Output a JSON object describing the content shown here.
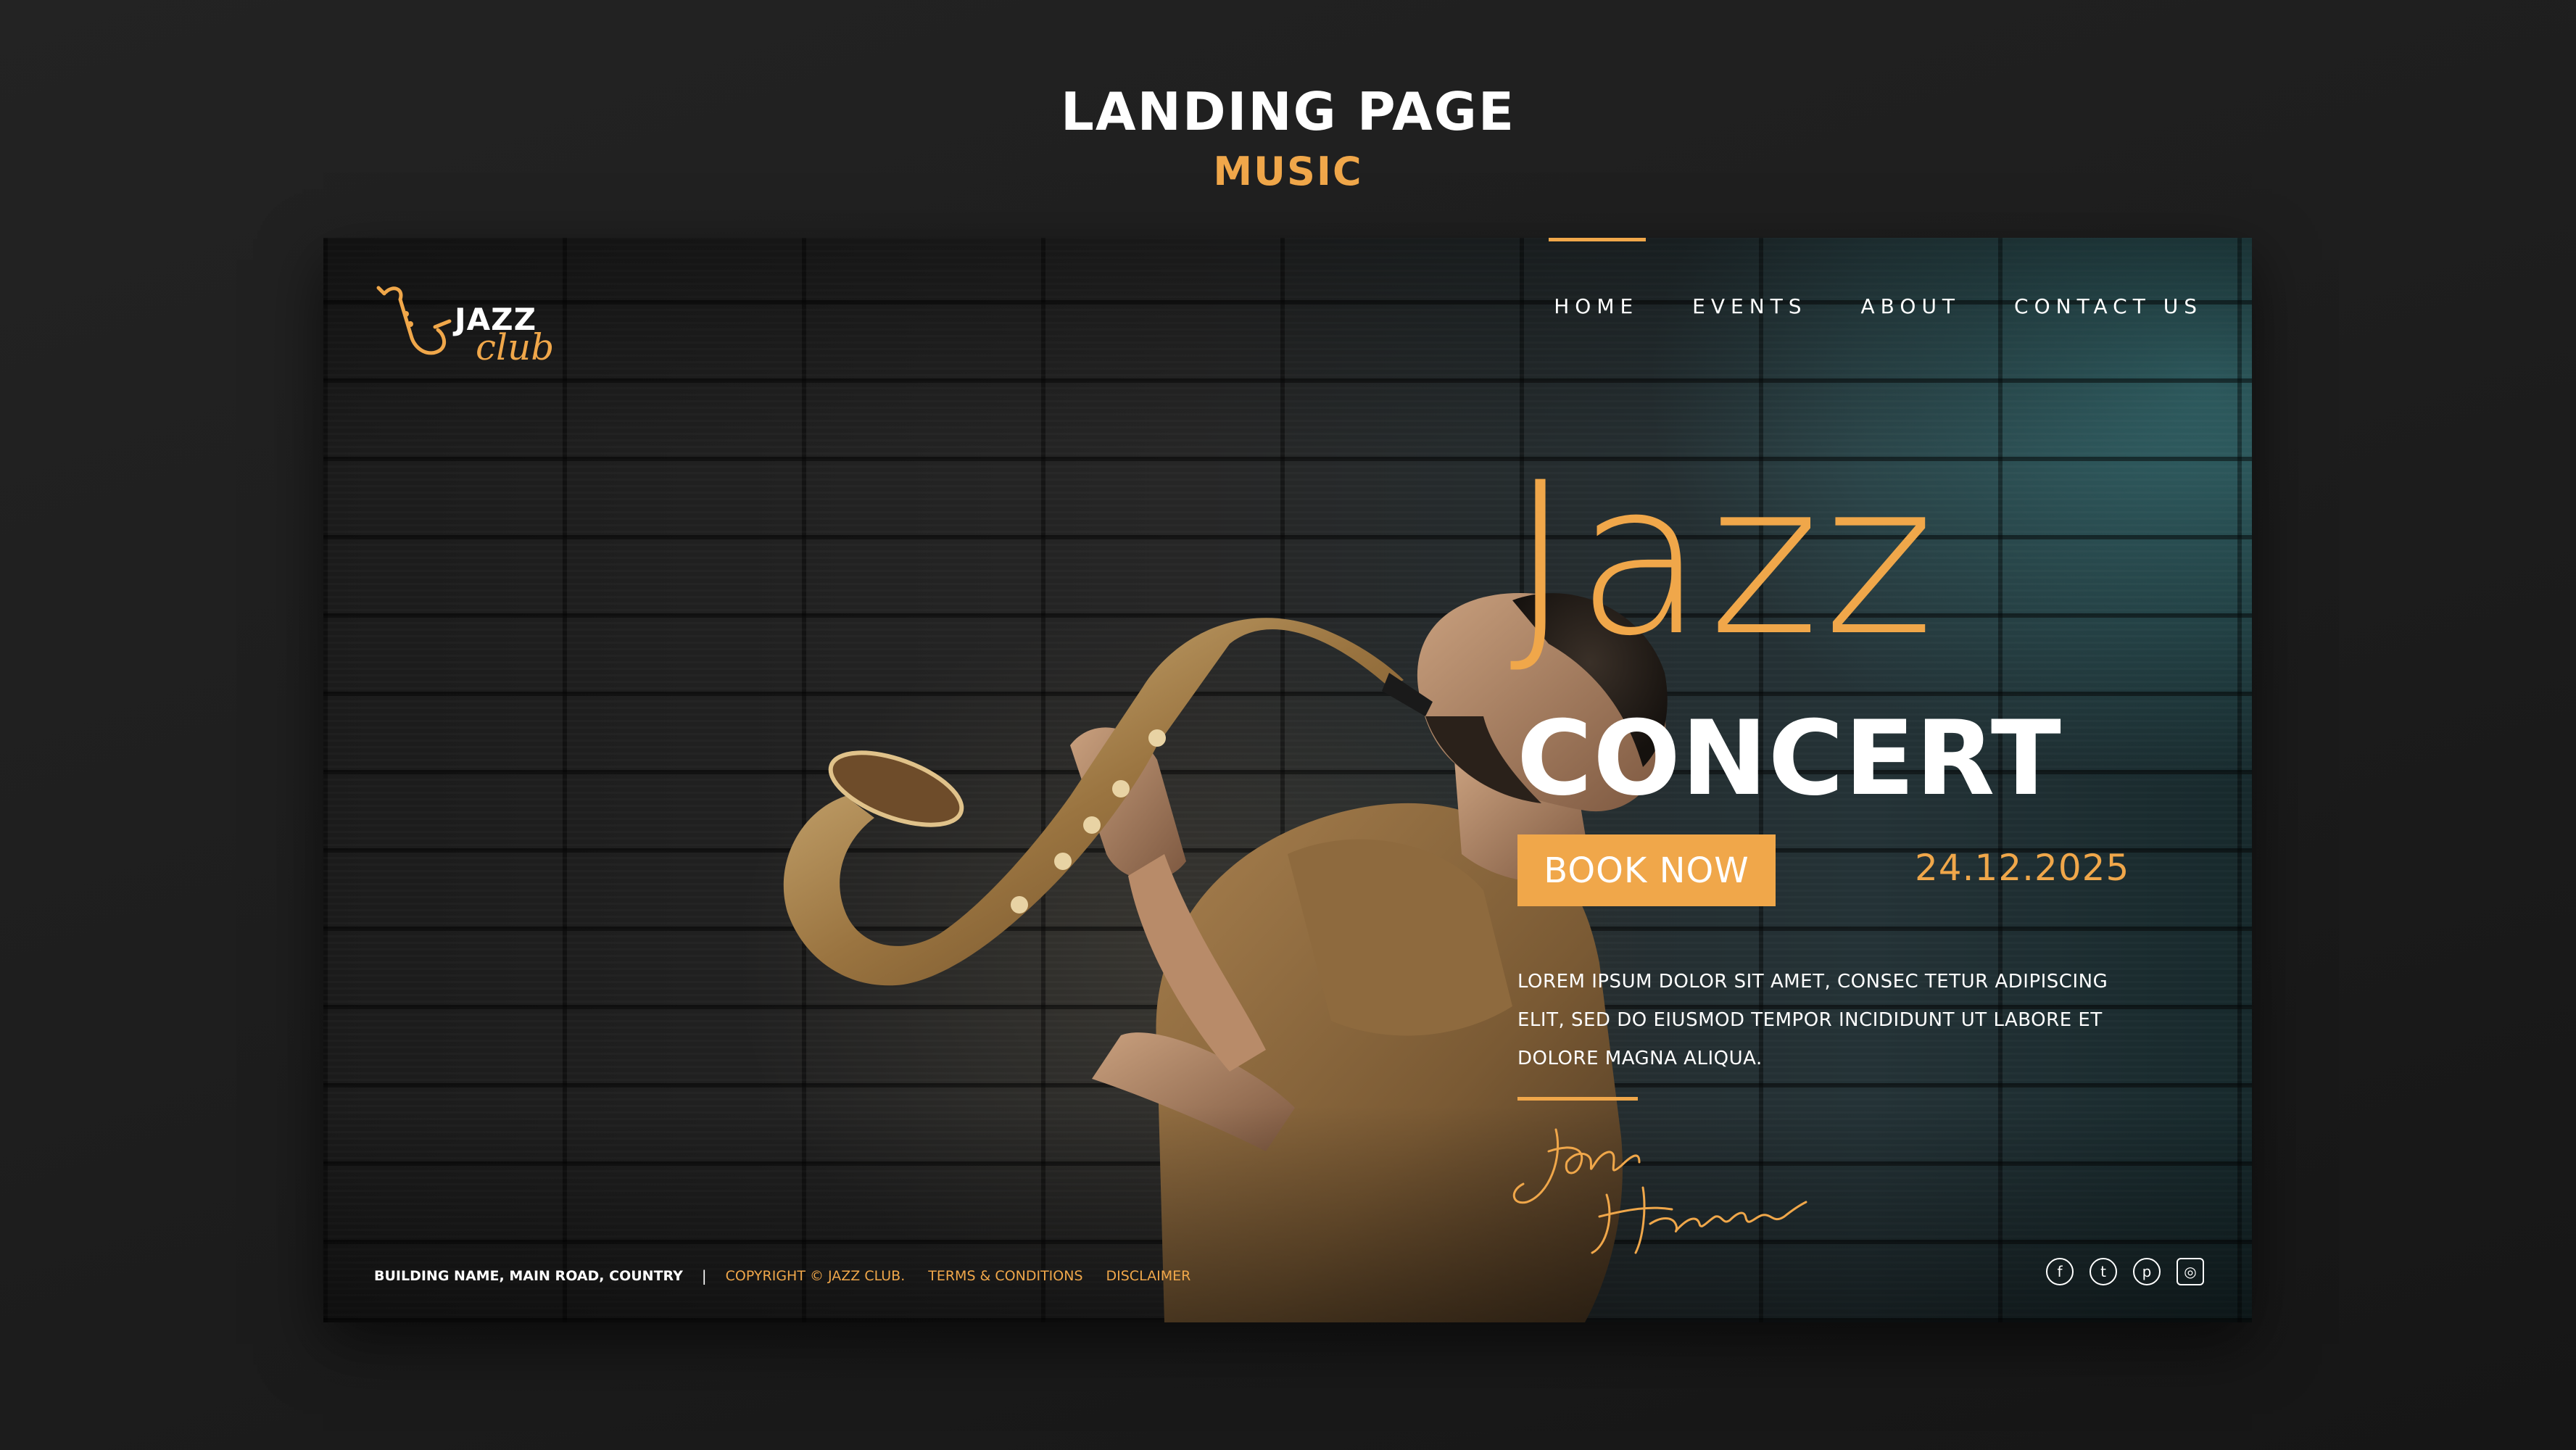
{
  "showcase": {
    "title": "LANDING PAGE",
    "subtitle": "MUSIC"
  },
  "logo": {
    "word1": "JAZZ",
    "word2": "club",
    "icon": "saxophone-icon"
  },
  "nav": {
    "items": [
      "HOME",
      "EVENTS",
      "ABOUT",
      "CONTACT US"
    ],
    "active": "HOME"
  },
  "hero": {
    "title_line1": "Jazz",
    "title_line2": "CONCERT",
    "button_label": "BOOK NOW",
    "date": "24.12.2025",
    "description": "LOREM IPSUM DOLOR SIT AMET, CONSEC TETUR ADIPISCING ELIT, SED DO EIUSMOD TEMPOR INCIDIDUNT UT LABORE ET DOLORE MAGNA ALIQUA.",
    "signature": "John Harrison"
  },
  "footer": {
    "address": "BUILDING NAME, MAIN ROAD, COUNTRY",
    "separator": "|",
    "copyright": "COPYRIGHT © JAZZ CLUB.",
    "terms": "TERMS & CONDITIONS",
    "disclaimer": "DISCLAIMER"
  },
  "social": [
    {
      "icon": "facebook-icon",
      "glyph": "f"
    },
    {
      "icon": "twitter-icon",
      "glyph": "t"
    },
    {
      "icon": "pinterest-icon",
      "glyph": "p"
    },
    {
      "icon": "instagram-icon",
      "glyph": "◎"
    }
  ],
  "colors": {
    "accent": "#f0a74a",
    "background": "#1e1e1e",
    "text": "#ffffff"
  }
}
